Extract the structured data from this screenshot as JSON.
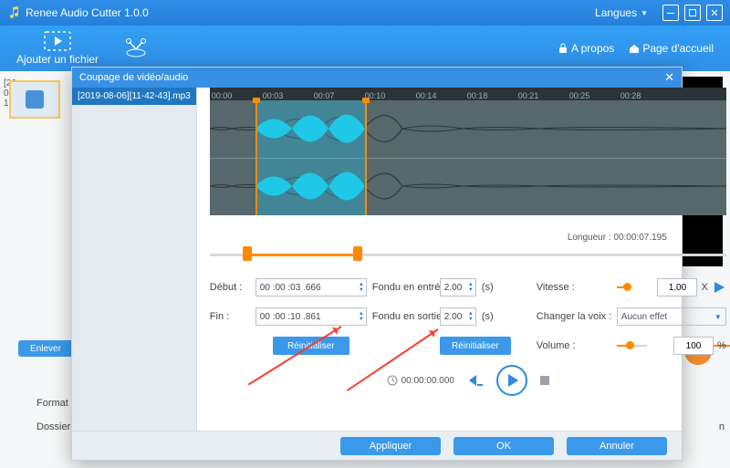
{
  "titlebar": {
    "app_name": "Renee Audio Cutter 1.0.0",
    "lang_label": "Langues"
  },
  "toolbar": {
    "add_file": "Ajouter un fichier",
    "about": "A propos",
    "home": "Page d'accueil"
  },
  "bg": {
    "remove": "Enlever",
    "format": "Format de so",
    "folder": "Dossier de so",
    "suffix": "n"
  },
  "modal": {
    "title": "Coupage de vidéo/audio",
    "file_item": "[2019-08-06][11-42-43].mp3",
    "ruler": [
      "00:00",
      "00:03",
      "00:07",
      "00:10",
      "00:14",
      "00:18",
      "00:21",
      "00:25",
      "00:28"
    ],
    "length_label": "Longueur : 00:00:07.195",
    "form": {
      "debut": "Début :",
      "debut_val": "00 :00 :03 .666",
      "fin": "Fin :",
      "fin_val": "00 :00 :10 .861",
      "fadein": "Fondu en entrée :",
      "fadein_val": "2.00",
      "unit": "(s)",
      "fadeout": "Fondu en sortie :",
      "fadeout_val": "2.00",
      "reset": "Réinitialiser",
      "speed": "Vitesse :",
      "speed_val": "1.00",
      "speed_unit": "X",
      "voice": "Changer la voix :",
      "voice_val": "Aucun effet",
      "volume": "Volume :",
      "volume_val": "100",
      "volume_unit": "%"
    },
    "playbar_time": "00:00:00.000",
    "footer": {
      "apply": "Appliquer",
      "ok": "OK",
      "cancel": "Annuler"
    }
  }
}
